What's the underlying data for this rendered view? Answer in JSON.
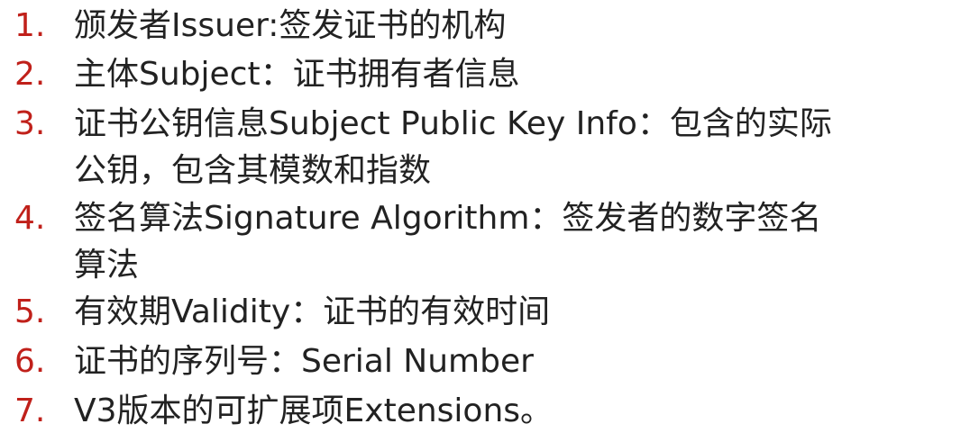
{
  "colors": {
    "number": "#c0201a",
    "text": "#222222",
    "background": "#ffffff"
  },
  "items": [
    {
      "number": "1.",
      "lines": [
        "颁发者Issuer:签发证书的机构"
      ]
    },
    {
      "number": "2.",
      "lines": [
        "主体Subject：证书拥有者信息"
      ]
    },
    {
      "number": "3.",
      "lines": [
        "证书公钥信息Subject Public Key Info：包含的实际",
        "公钥，包含其模数和指数"
      ]
    },
    {
      "number": "4.",
      "lines": [
        "签名算法Signature Algorithm：签发者的数字签名",
        "算法"
      ]
    },
    {
      "number": "5.",
      "lines": [
        "有效期Validity：证书的有效时间"
      ]
    },
    {
      "number": "6.",
      "lines": [
        "证书的序列号：Serial Number"
      ]
    },
    {
      "number": "7.",
      "lines": [
        "V3版本的可扩展项Extensions。"
      ]
    }
  ]
}
